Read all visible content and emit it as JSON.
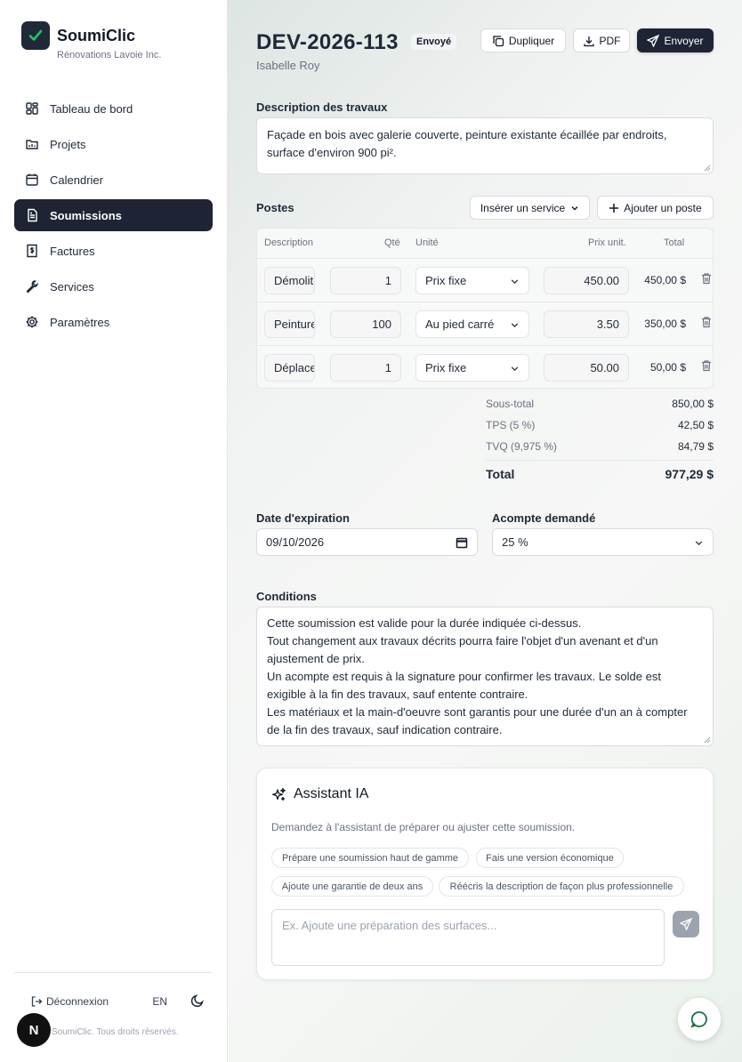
{
  "brand": {
    "name": "SoumiClic",
    "company": "Rénovations Lavoie Inc."
  },
  "nav": [
    {
      "label": "Tableau de bord",
      "icon": "dashboard-icon"
    },
    {
      "label": "Projets",
      "icon": "folder-icon"
    },
    {
      "label": "Calendrier",
      "icon": "calendar-icon"
    },
    {
      "label": "Soumissions",
      "icon": "file-icon",
      "active": true
    },
    {
      "label": "Factures",
      "icon": "invoice-icon"
    },
    {
      "label": "Services",
      "icon": "wrench-icon"
    },
    {
      "label": "Paramètres",
      "icon": "gear-icon"
    }
  ],
  "footer": {
    "logout": "Déconnexion",
    "lang": "EN",
    "copyright": "SoumiClic. Tous droits réservés.",
    "badge": "N"
  },
  "header": {
    "number": "DEV-2026-113",
    "status": "Envoyé",
    "client": "Isabelle Roy",
    "duplicate": "Dupliquer",
    "pdf": "PDF",
    "send": "Envoyer"
  },
  "description": {
    "label": "Description des travaux",
    "text": "Façade en bois avec galerie couverte, peinture existante écaillée par endroits, surface d'environ 900 pi²."
  },
  "items": {
    "label": "Postes",
    "insert_service": "Insérer un service",
    "add_item": "Ajouter un poste",
    "columns": {
      "description": "Description",
      "qty": "Qté",
      "unit": "Unité",
      "price": "Prix unit.",
      "total": "Total"
    },
    "rows": [
      {
        "description": "Démolition",
        "qty": "1",
        "unit": "Prix fixe",
        "price": "450.00",
        "total": "450,00 $"
      },
      {
        "description": "Peinture",
        "qty": "100",
        "unit": "Au pied carré",
        "price": "3.50",
        "total": "350,00 $"
      },
      {
        "description": "Déplacement",
        "qty": "1",
        "unit": "Prix fixe",
        "price": "50.00",
        "total": "50,00 $"
      }
    ]
  },
  "totals": {
    "subtotal_label": "Sous-total",
    "subtotal": "850,00 $",
    "tps_label": "TPS (5 %)",
    "tps": "42,50 $",
    "tvq_label": "TVQ (9,975 %)",
    "tvq": "84,79 $",
    "total_label": "Total",
    "total": "977,29 $"
  },
  "expiry": {
    "label": "Date d'expiration",
    "value": "09/10/2026"
  },
  "deposit": {
    "label": "Acompte demandé",
    "value": "25 %"
  },
  "conditions": {
    "label": "Conditions",
    "lines": [
      "Cette soumission est valide pour la durée indiquée ci-dessus.",
      "Tout changement aux travaux décrits pourra faire l'objet d'un avenant et d'un ajustement de prix.",
      "Un acompte est requis à la signature pour confirmer les travaux. Le solde est exigible à la fin des travaux, sauf entente contraire.",
      "Les matériaux et la main-d'oeuvre sont garantis pour une durée d'un an à compter de la fin des travaux, sauf indication contraire."
    ]
  },
  "assistant": {
    "title": "Assistant IA",
    "description": "Demandez à l'assistant de préparer ou ajuster cette soumission.",
    "chips": [
      "Prépare une soumission haut de gamme",
      "Fais une version économique",
      "Ajoute une garantie de deux ans",
      "Réécris la description de façon plus professionnelle"
    ],
    "placeholder": "Ex. Ajoute une préparation des surfaces..."
  },
  "colors": {
    "primary": "#1e2433",
    "background": "#f5f6f6",
    "muted": "#6b7280"
  }
}
